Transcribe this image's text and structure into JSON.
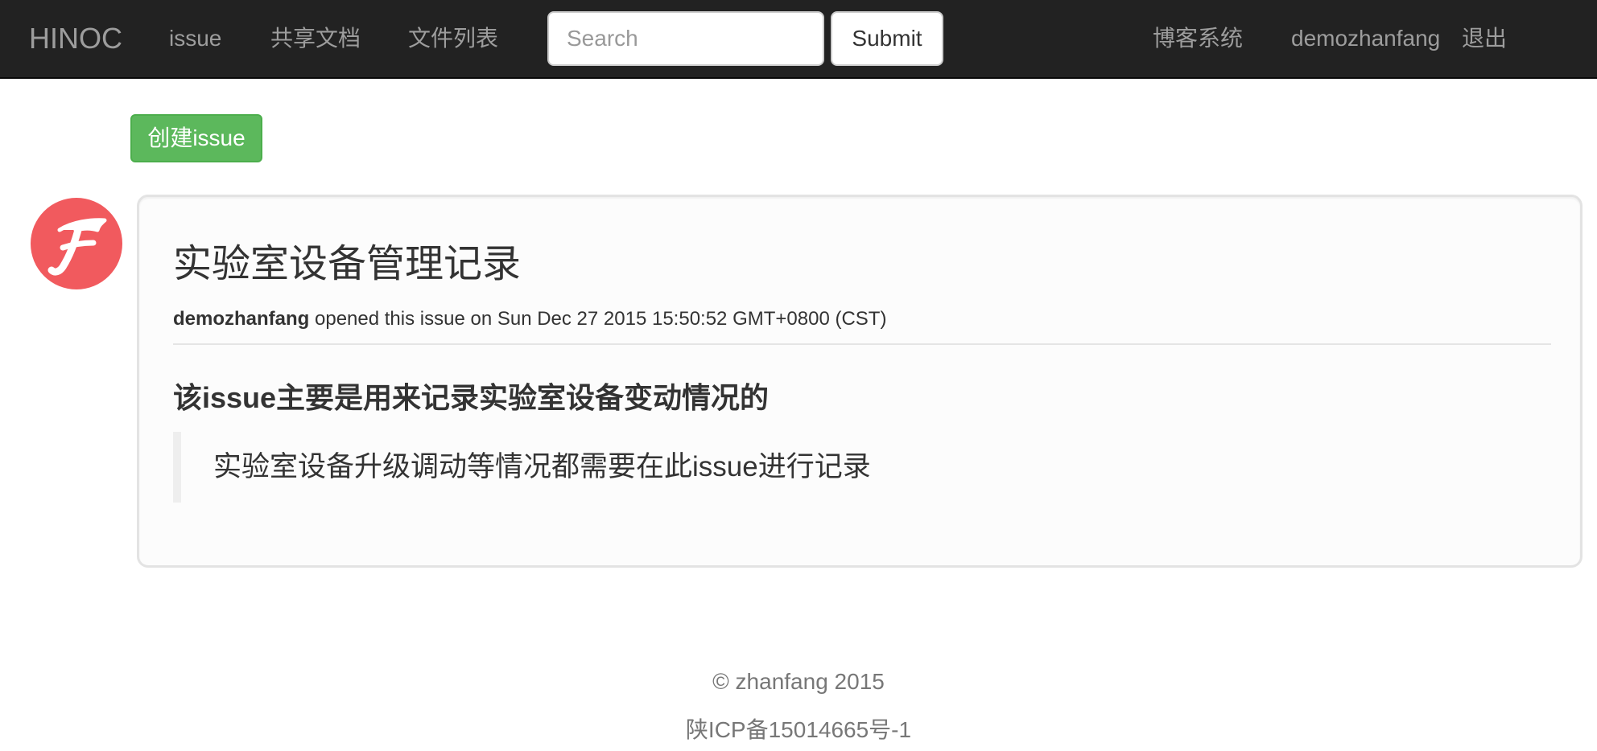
{
  "navbar": {
    "brand": "HINOC",
    "links": [
      {
        "label": "issue"
      },
      {
        "label": "共享文档"
      },
      {
        "label": "文件列表"
      }
    ],
    "search": {
      "placeholder": "Search",
      "value": ""
    },
    "submit_label": "Submit",
    "right_links": [
      {
        "label": "博客系统"
      },
      {
        "label": "demozhanfang"
      },
      {
        "label": "退出"
      }
    ]
  },
  "actions": {
    "create_issue_label": "创建issue"
  },
  "issue": {
    "avatar_letter": "F",
    "title": "实验室设备管理记录",
    "author": "demozhanfang",
    "opened_text": " opened this issue on Sun Dec 27 2015 15:50:52 GMT+0800 (CST)",
    "body_heading": "该issue主要是用来记录实验室设备变动情况的",
    "body_quote": "实验室设备升级调动等情况都需要在此issue进行记录"
  },
  "footer": {
    "copyright": "© zhanfang 2015",
    "icp": "陕ICP备15014665号-1"
  },
  "colors": {
    "navbar_bg": "#222222",
    "nav_text": "#9d9d9d",
    "create_button": "#5cb85c",
    "avatar_bg": "#f15a5e",
    "panel_bg": "#fcfcfc"
  }
}
